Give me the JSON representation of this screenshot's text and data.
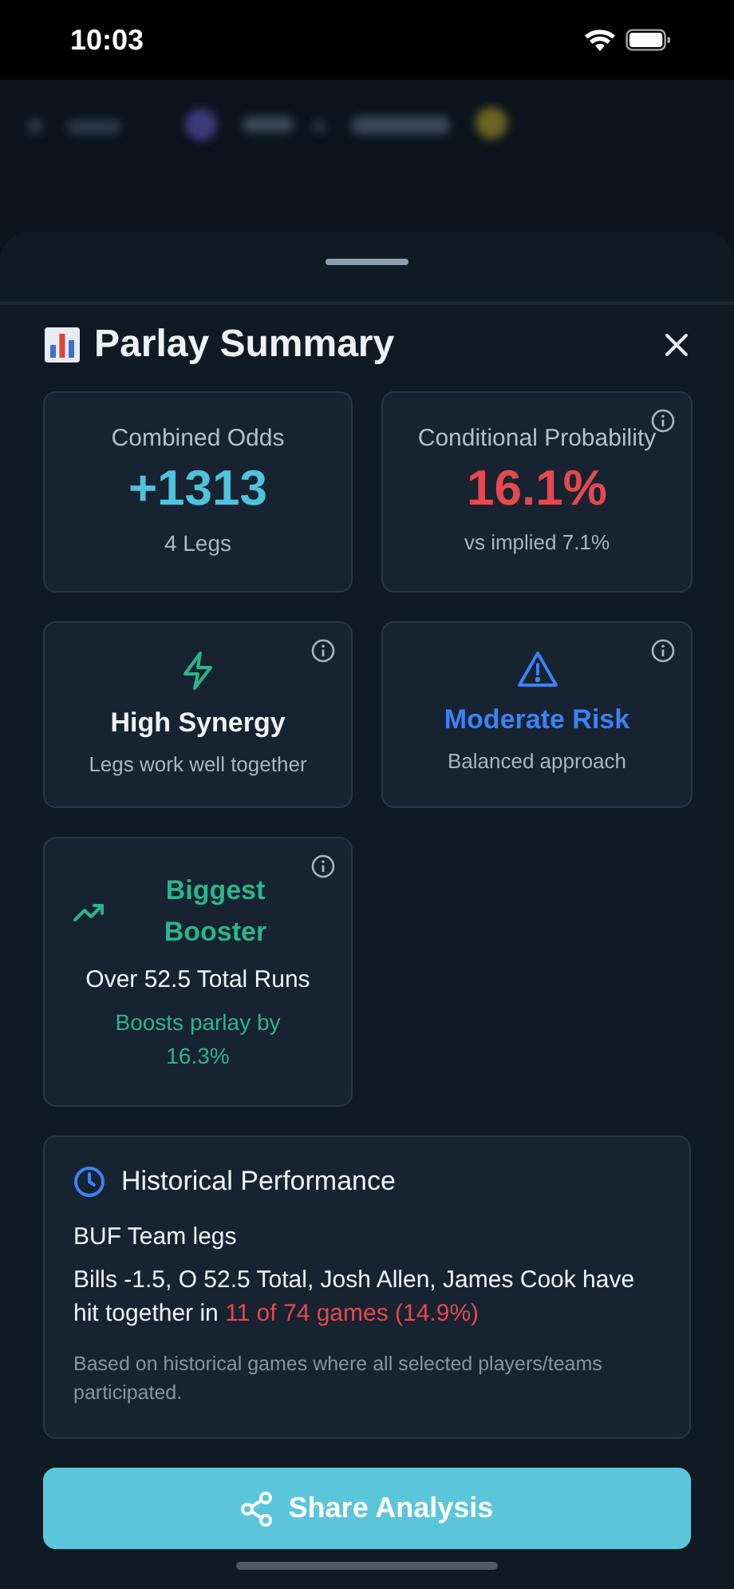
{
  "status_bar": {
    "time": "10:03"
  },
  "sheet": {
    "title": "Parlay Summary"
  },
  "cards": [
    {
      "kind": "stat",
      "label": "Combined Odds",
      "value": "+1313",
      "note": "4 Legs",
      "color": "#4fc3dc",
      "info": false
    },
    {
      "kind": "stat",
      "label": "Conditional Probability",
      "value": "16.1%",
      "note": "vs implied 7.1%",
      "color": "#e5484d",
      "info": true
    },
    {
      "kind": "synergy",
      "title": "High Synergy",
      "note": "Legs work well together",
      "color": "#eef2f6",
      "info": true
    },
    {
      "kind": "risk",
      "title": "Moderate Risk",
      "note": "Balanced approach",
      "color": "#3b82f6",
      "info": true
    },
    {
      "kind": "booster",
      "title": "Biggest Booster",
      "detail": "Over 52.5 Total Runs",
      "note": "Boosts parlay by 16.3%",
      "color": "#2bb58a",
      "info": true
    }
  ],
  "history": {
    "title": "Historical Performance",
    "subtitle": "BUF Team legs",
    "body": "Bills -1.5, O 52.5 Total, Josh Allen, James Cook have hit together in",
    "highlight": "11 of 74 games (14.9%)",
    "footnote": "Based on historical games where all selected players/teams participated."
  },
  "share_button": {
    "label": "Share Analysis"
  }
}
